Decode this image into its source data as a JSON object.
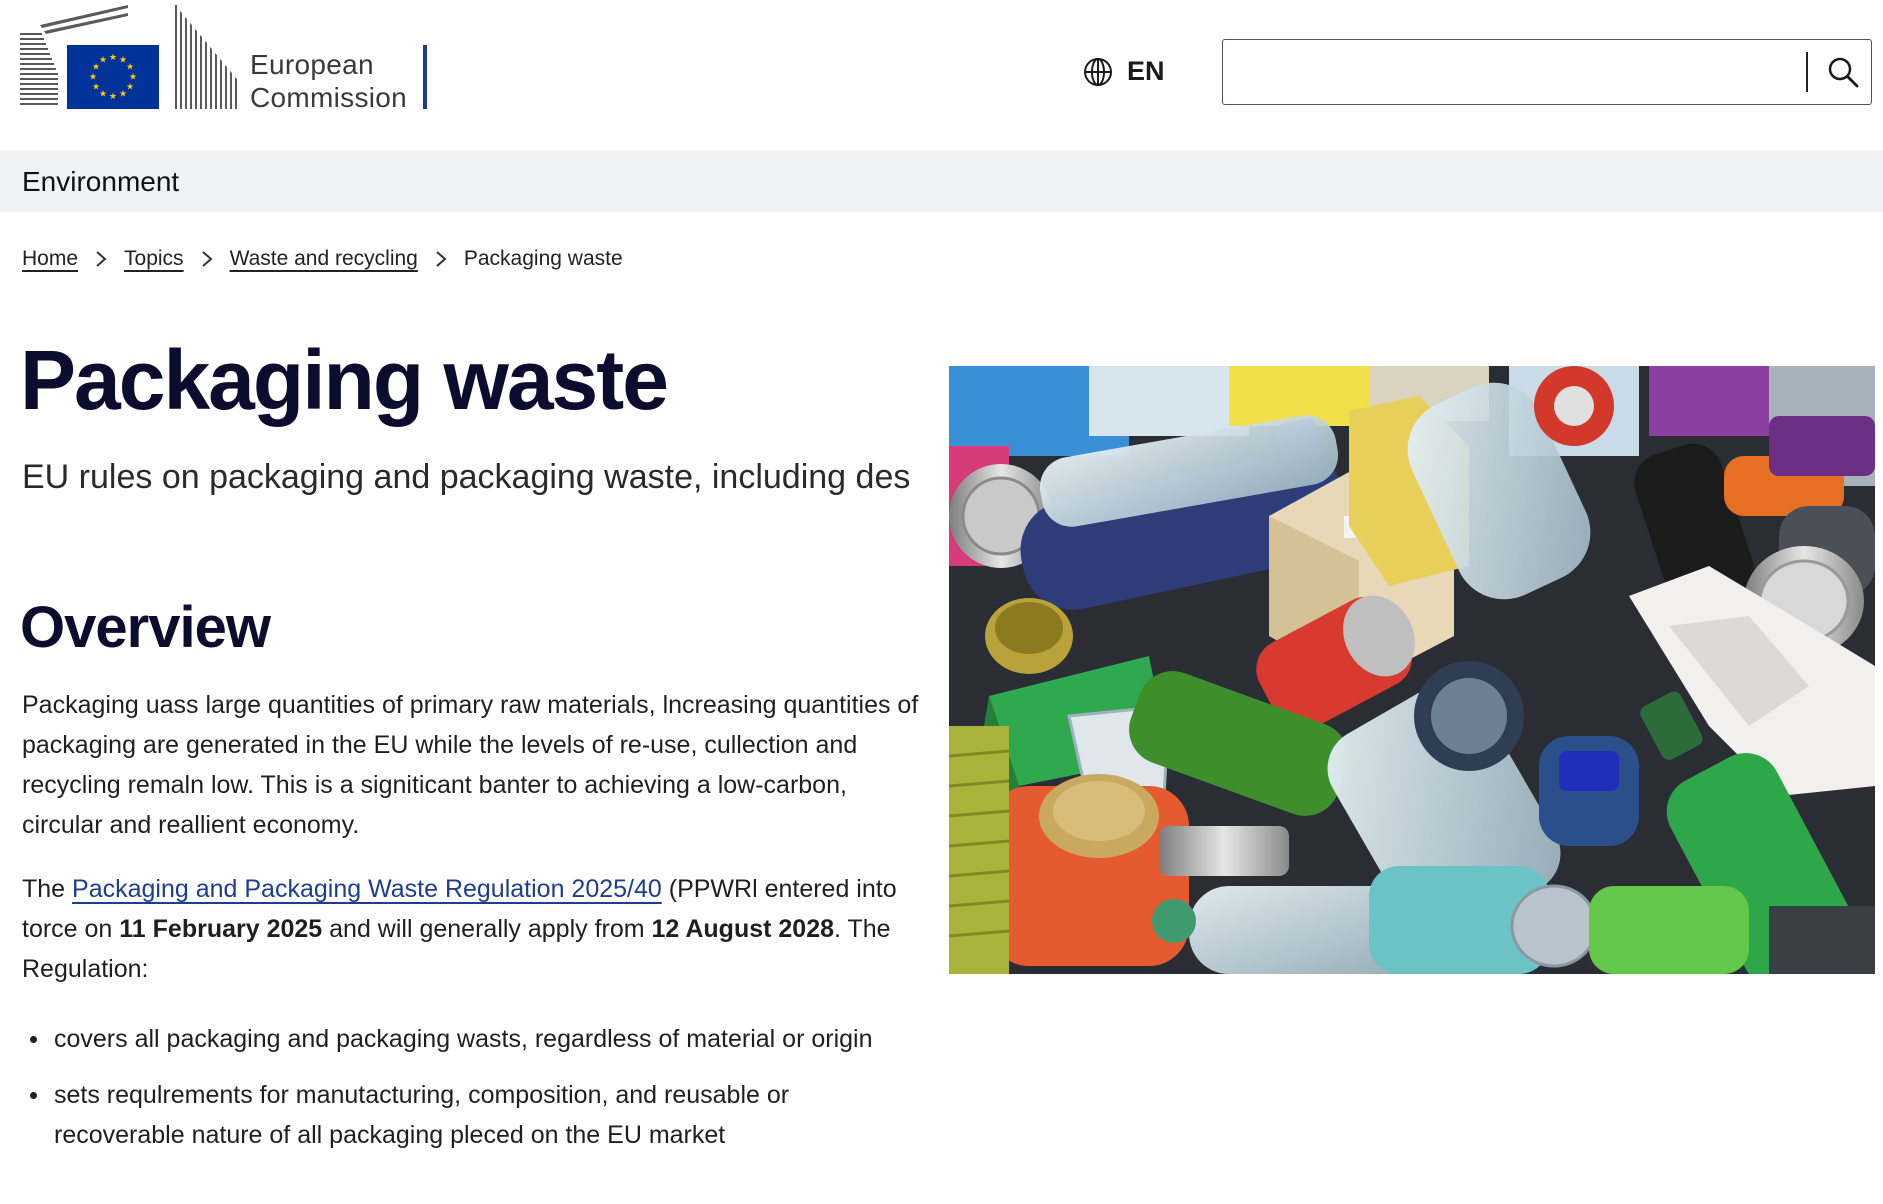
{
  "header": {
    "logo_line1": "European",
    "logo_line2": "Commission",
    "language": "EN",
    "search": {
      "value": "",
      "placeholder": ""
    }
  },
  "site": {
    "name": "Environment"
  },
  "breadcrumb": {
    "items": [
      "Home",
      "Topics",
      "Waste and recycling"
    ],
    "current": "Packaging waste"
  },
  "page": {
    "title": "Packaging waste",
    "lead": "EU rules on packaging and packaging waste, including des",
    "overview_heading": "Overview",
    "para1": "Packaging uass large quantities of primary raw materials, lncreasing quantities of packaging are generated in the EU while the levels of re-use, cullection and recycling remaln low.  This is a signiticant banter to achieving a low-carbon, circular and reallient economy.",
    "para2": {
      "before": "The ",
      "link": "Packaging and Packaging Waste Regulation 2025/40",
      "after1": " (PPWRl entered into torce on ",
      "date1": "11 February 2025",
      "after2": " and will generally apply from ",
      "date2": "12 August 2028",
      "after3": ". The Regulation:"
    },
    "bullets": [
      "covers all packaging and packaging wasts, regardless of material or origin",
      "sets requlrements for manutacturing, composition, and reusable or recoverable nature of all packaging pleced on the EU market"
    ]
  },
  "colors": {
    "eu_blue": "#003399",
    "eu_yellow": "#ffcc00",
    "title_navy": "#0c0c2e",
    "link_blue": "#1d3d8f",
    "sitebar_bg": "#f1f2f5"
  },
  "icons": {
    "language": "globe-icon",
    "search": "search-icon",
    "breadcrumb_separator": "chevron-right-icon"
  }
}
